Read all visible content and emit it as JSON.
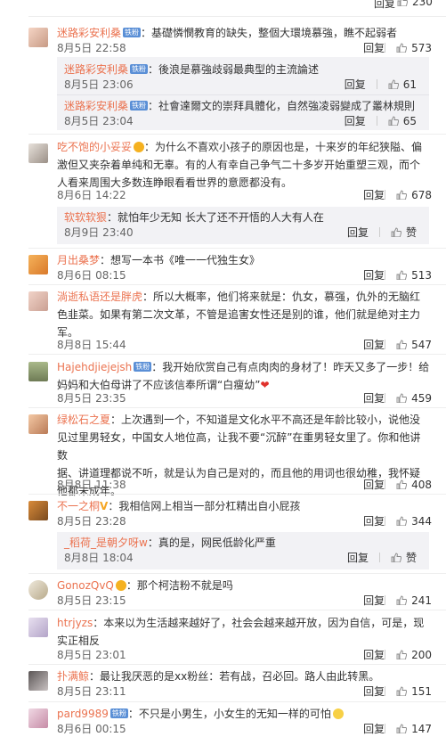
{
  "top": {
    "reply": "回复",
    "likes": "230"
  },
  "comments": [
    {
      "name": "迷路彩安利桑",
      "text": "：基礎憐憫教育的缺失，整個大環境慕強，瞧不起弱者",
      "time": "8月5日 22:58",
      "reply": "回复",
      "likes": "573",
      "replies": [
        {
          "name": "迷路彩安利桑",
          "text": "：後浪是慕強歧弱最典型的主流論述",
          "time": "8月5日 23:06",
          "reply": "回复",
          "likes": "61"
        },
        {
          "name": "迷路彩安利桑",
          "text": "：社會達爾文的崇拜具體化，自然強凌弱變成了叢林規則",
          "time": "8月5日 23:04",
          "reply": "回复",
          "likes": "65"
        }
      ]
    },
    {
      "name": "吃不饱的小妥妥",
      "text1": "：为什么不喜欢小孩子的原因也是，十来岁的年纪狭隘、偏",
      "text2": "激但又夹杂着单纯和无辜。有的人有幸自己争气二十多岁开始重塑三观，而个",
      "text3": "人看来周围大多数连睁眼看看世界的意愿都没有。",
      "time": "8月6日 14:22",
      "reply": "回复",
      "likes": "678",
      "replies": [
        {
          "name": "软软软狠",
          "text": "：就怕年少无知 长大了还不开悟的人大有人在",
          "time": "8月9日 23:40",
          "reply": "回复",
          "likes": "赞"
        }
      ]
    },
    {
      "name": "月出桑梦",
      "text": "：想写一本书《唯一一代独生女》",
      "time": "8月6日 08:15",
      "reply": "回复",
      "likes": "513"
    },
    {
      "name": "淌逝私语还是胖虎",
      "text1": "：所以大概率，他们将来就是：仇女，慕强，仇外的无脑红",
      "text2": "色韭菜。如果有第二次文革，不管是追害女性还是别的谁，他们就是绝对主力",
      "text3": "军。",
      "time": "8月8日 15:44",
      "reply": "回复",
      "likes": "547"
    },
    {
      "name": "Hajehdjiejejsh",
      "text1": "：我开始欣赏自己有点肉肉的身材了！昨天又多了一步！给",
      "text2": "妈妈和大伯母讲了不应该信奉所谓“白瘦幼”",
      "time": "8月5日 23:35",
      "reply": "回复",
      "likes": "459"
    },
    {
      "name": "绿松石之夏",
      "text1": "：上次遇到一个，不知道是文化水平不高还是年龄比较小，说他没",
      "text2": "见过里男轻女，中国女人地位高，让我不要“沉醉”在重男轻女里了。你和他讲数",
      "text3": "据、讲道理都说不听，就是认为自己是对的，而且他的用词也很幼稚，我怀疑",
      "text4": "他都未成年。",
      "time": "8月8日 11:38",
      "reply": "回复",
      "likes": "408"
    },
    {
      "name": "不一之桐",
      "text": "：我相信网上相当一部分杠精出自小屁孩",
      "time": "8月5日 23:28",
      "reply": "回复",
      "likes": "344",
      "replies": [
        {
          "name": "_稻荷_是朝夕呀w",
          "text": "：真的是，网民低龄化严重",
          "time": "8月8日 18:04",
          "reply": "回复",
          "likes": "赞"
        }
      ]
    },
    {
      "name": "GonozQvQ",
      "text": "：那个柯洁粉不就是吗",
      "time": "8月5日 23:15",
      "reply": "回复",
      "likes": "241"
    },
    {
      "name": "htrjyzs",
      "text1": "：本来以为生活越来越好了，社会会越来越开放，因为自信，可是，现",
      "text2": "实正相反",
      "time": "8月5日 23:01",
      "reply": "回复",
      "likes": "200"
    },
    {
      "name": "扑满鲸",
      "text": "：最让我厌恶的是xx粉丝：若有战，召必回。路人由此转黑。",
      "time": "8月5日 23:11",
      "reply": "回复",
      "likes": "151"
    },
    {
      "name": "pard9989",
      "text": "：不只是小男生，小女生的无知一样的可怕",
      "time": "8月6日 00:15",
      "reply": "回复",
      "likes": "147"
    }
  ],
  "colors": {
    "name": "#eb7350",
    "badge": "#5a8fd6",
    "reply_bg": "#f2f2f5"
  }
}
